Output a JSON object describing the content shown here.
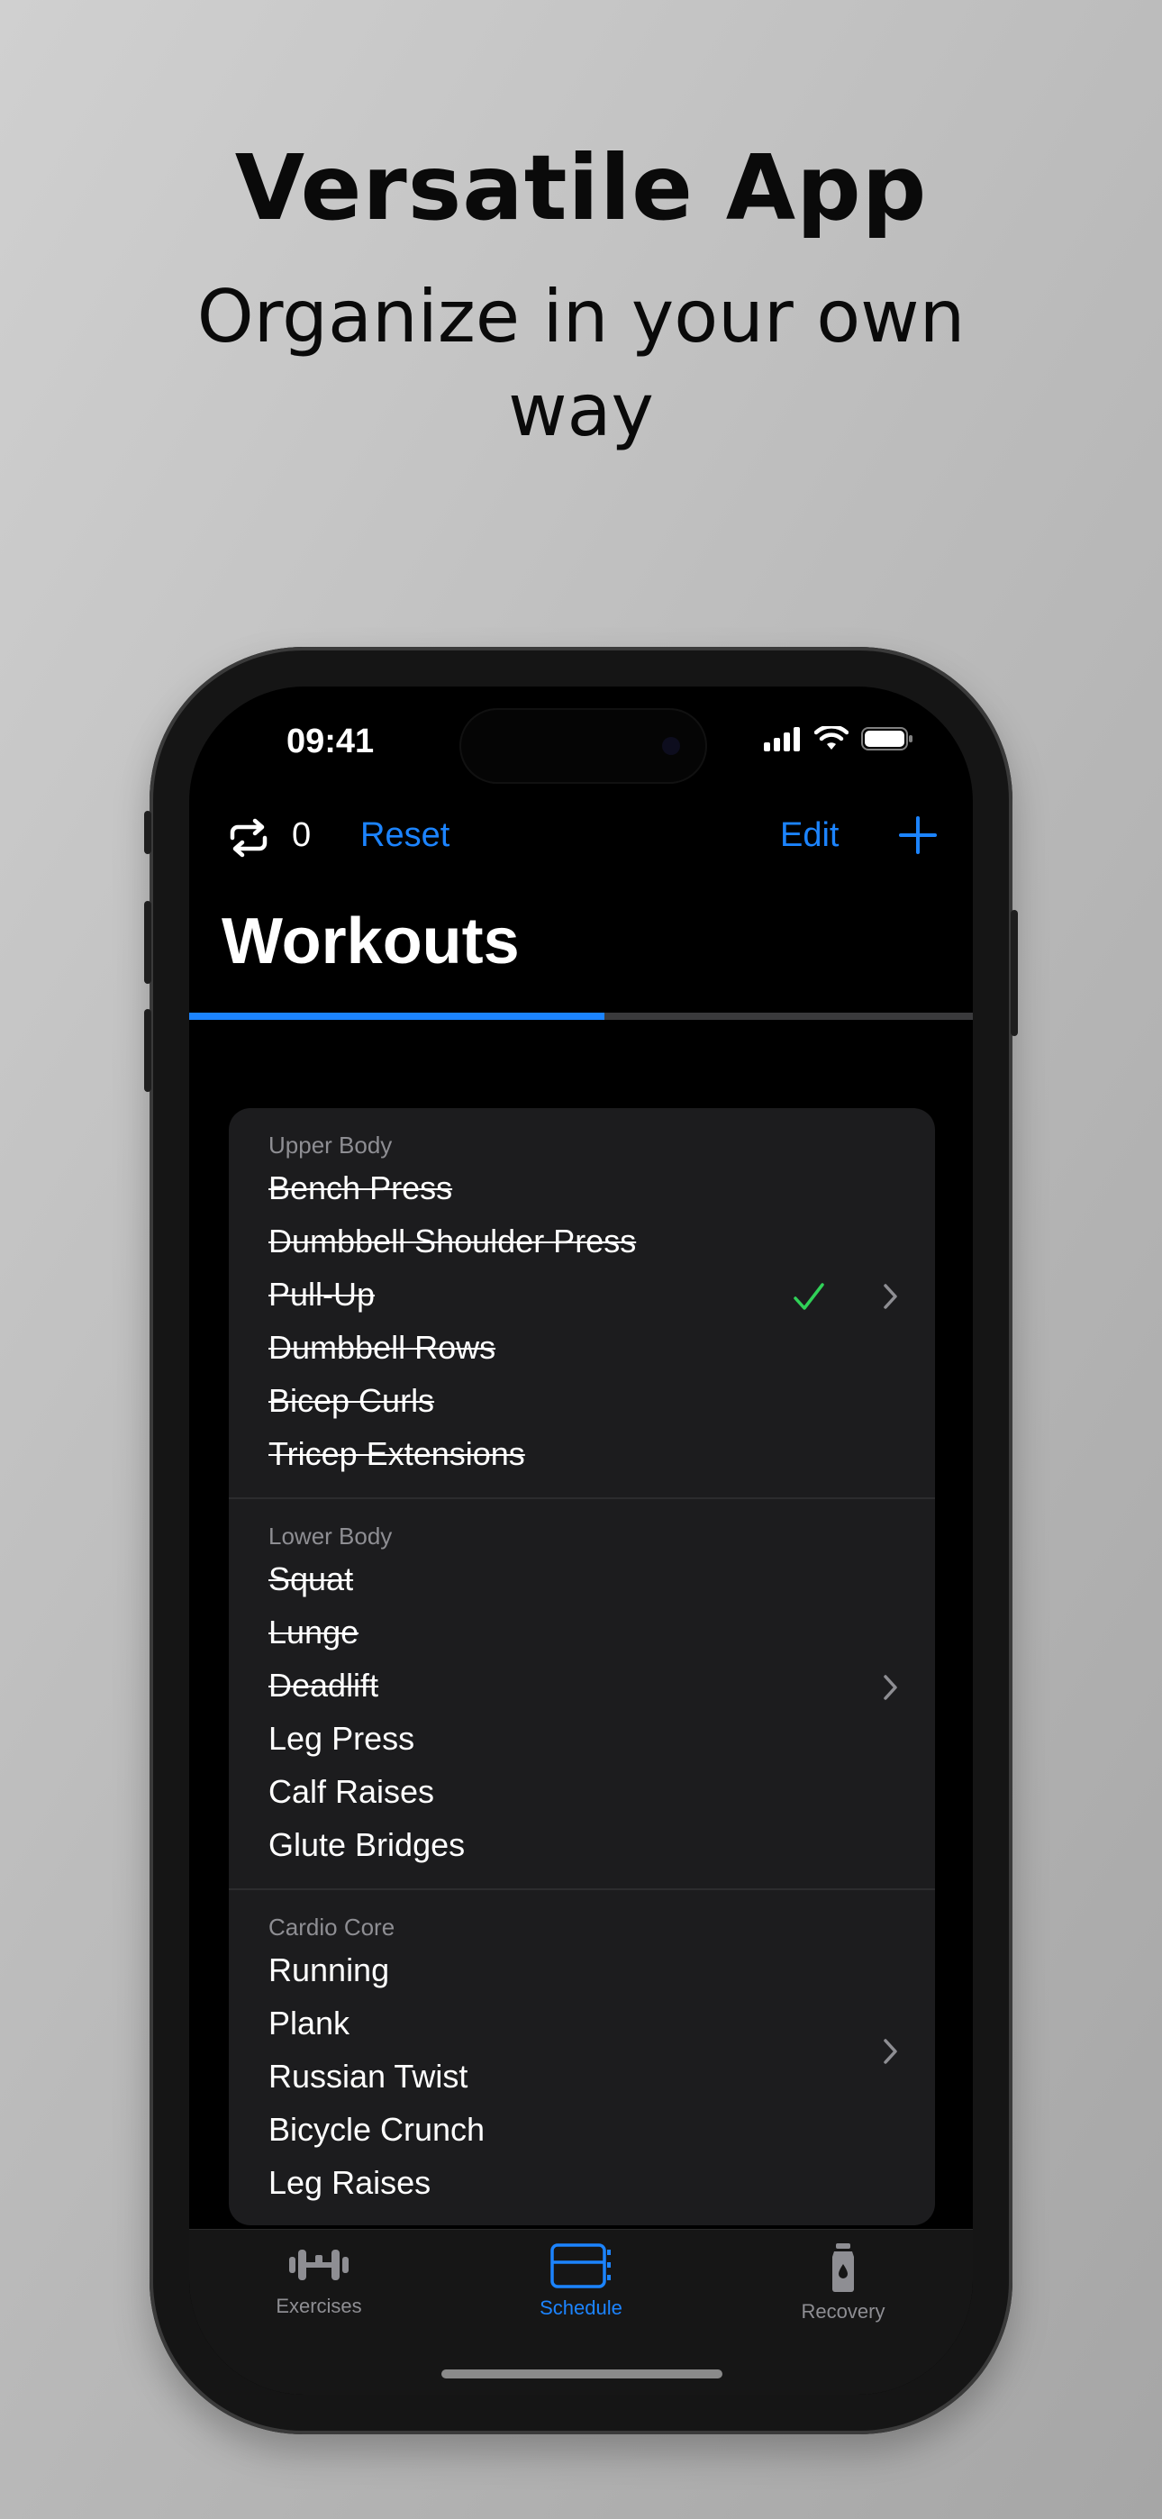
{
  "promo": {
    "headline": "Versatile App",
    "subheadline": "Organize in your own way"
  },
  "status_bar": {
    "time": "09:41"
  },
  "toolbar": {
    "repeat_count": "0",
    "reset_label": "Reset",
    "edit_label": "Edit"
  },
  "page": {
    "title": "Workouts",
    "progress_fraction": 0.53
  },
  "sections": [
    {
      "title": "Upper Body",
      "completed_all": true,
      "items": [
        {
          "label": "Bench Press",
          "done": true
        },
        {
          "label": "Dumbbell Shoulder Press",
          "done": true
        },
        {
          "label": "Pull-Up",
          "done": true
        },
        {
          "label": "Dumbbell Rows",
          "done": true
        },
        {
          "label": "Bicep Curls",
          "done": true
        },
        {
          "label": "Tricep Extensions",
          "done": true
        }
      ]
    },
    {
      "title": "Lower Body",
      "completed_all": false,
      "items": [
        {
          "label": "Squat",
          "done": true
        },
        {
          "label": "Lunge",
          "done": true
        },
        {
          "label": "Deadlift",
          "done": true
        },
        {
          "label": "Leg Press",
          "done": false
        },
        {
          "label": "Calf Raises",
          "done": false
        },
        {
          "label": "Glute Bridges",
          "done": false
        }
      ]
    },
    {
      "title": "Cardio Core",
      "completed_all": false,
      "items": [
        {
          "label": "Running",
          "done": false
        },
        {
          "label": "Plank",
          "done": false
        },
        {
          "label": "Russian Twist",
          "done": false
        },
        {
          "label": "Bicycle Crunch",
          "done": false
        },
        {
          "label": "Leg Raises",
          "done": false
        }
      ]
    }
  ],
  "tabs": [
    {
      "label": "Exercises",
      "icon": "dumbbell-icon",
      "active": false
    },
    {
      "label": "Schedule",
      "icon": "schedule-icon",
      "active": true
    },
    {
      "label": "Recovery",
      "icon": "bottle-icon",
      "active": false
    }
  ],
  "colors": {
    "accent": "#1c84ff",
    "check": "#30d158",
    "card": "#1c1c1e",
    "inactive_tab": "#8e8e93"
  }
}
